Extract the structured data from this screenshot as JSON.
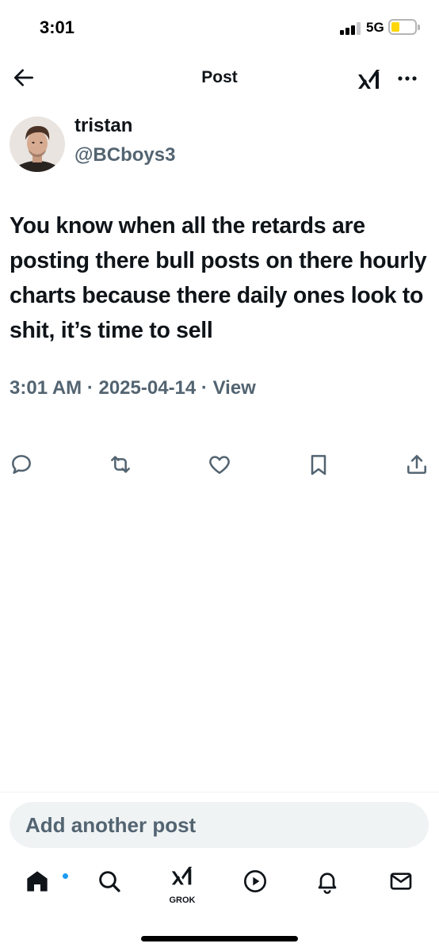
{
  "status_bar": {
    "time": "3:01",
    "network": "5G",
    "signal_bars": 3,
    "battery_level": 0.35,
    "battery_color": "#ffd60a"
  },
  "header": {
    "title": "Post",
    "back_icon": "arrow-left-icon",
    "grok_icon": "grok-icon",
    "more_icon": "more-horizontal-icon"
  },
  "author": {
    "display_name": "tristan",
    "handle": "@BCboys3"
  },
  "post": {
    "text": "You know when all the retards are posting there bull posts on there hourly charts because there daily ones look to shit, it’s time to sell",
    "time": "3:01 AM",
    "separator": "·",
    "date": "2025-04-14",
    "view_label": "View"
  },
  "actions": [
    {
      "icon": "reply-icon"
    },
    {
      "icon": "repost-icon"
    },
    {
      "icon": "like-icon"
    },
    {
      "icon": "bookmark-icon"
    },
    {
      "icon": "share-icon"
    }
  ],
  "composer": {
    "placeholder": "Add another post"
  },
  "tabbar": {
    "items": [
      {
        "icon": "home-icon",
        "has_notification_dot": true,
        "dot_color": "#1d9bf0"
      },
      {
        "icon": "search-icon"
      },
      {
        "icon": "grok-icon",
        "label": "GROK"
      },
      {
        "icon": "play-circle-icon"
      },
      {
        "icon": "bell-icon"
      },
      {
        "icon": "mail-icon"
      }
    ]
  },
  "colors": {
    "primary_text": "#0f1419",
    "secondary_text": "#536471",
    "accent": "#1d9bf0",
    "composer_bg": "#eff3f4"
  }
}
